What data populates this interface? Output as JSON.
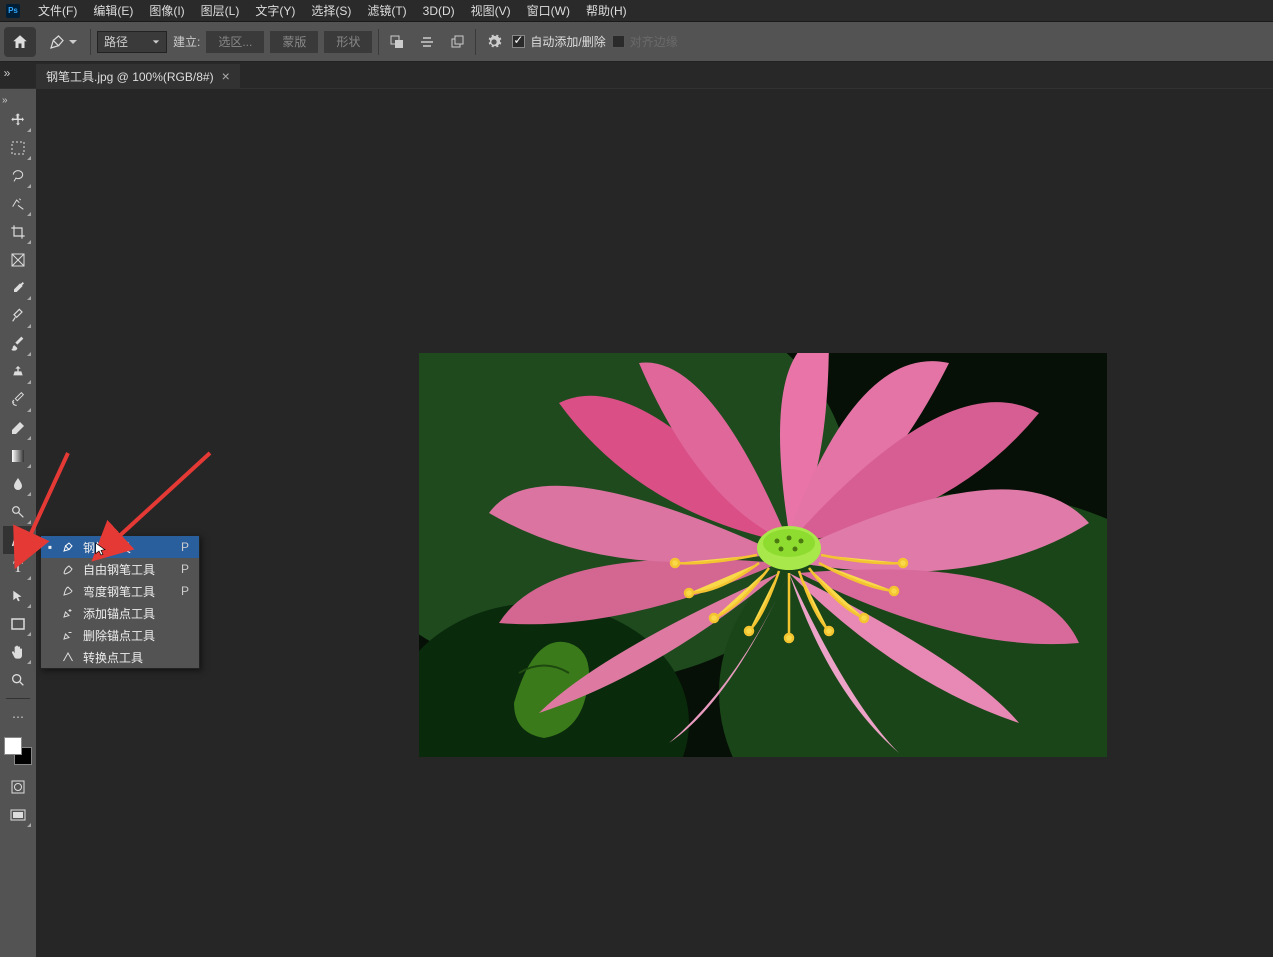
{
  "menubar": {
    "items": [
      "文件(F)",
      "编辑(E)",
      "图像(I)",
      "图层(L)",
      "文字(Y)",
      "选择(S)",
      "滤镜(T)",
      "3D(D)",
      "视图(V)",
      "窗口(W)",
      "帮助(H)"
    ]
  },
  "optionsbar": {
    "mode_select": "路径",
    "make_label": "建立:",
    "btn_selection": "选区...",
    "btn_mask": "蒙版",
    "btn_shape": "形状",
    "checkbox_label": "自动添加/删除",
    "snap_label": "对齐边缘"
  },
  "doctab": {
    "title": "钢笔工具.jpg @ 100%(RGB/8#)"
  },
  "flyout": {
    "items": [
      {
        "label": "钢笔工具",
        "key": "P",
        "selected": true,
        "icon": "pen"
      },
      {
        "label": "自由钢笔工具",
        "key": "P",
        "selected": false,
        "icon": "pen"
      },
      {
        "label": "弯度钢笔工具",
        "key": "P",
        "selected": false,
        "icon": "curve-pen"
      },
      {
        "label": "添加锚点工具",
        "key": "",
        "selected": false,
        "icon": "pen-plus"
      },
      {
        "label": "删除锚点工具",
        "key": "",
        "selected": false,
        "icon": "pen-minus"
      },
      {
        "label": "转换点工具",
        "key": "",
        "selected": false,
        "icon": "convert"
      }
    ]
  },
  "tools": [
    "move",
    "marquee",
    "lasso",
    "magic-wand",
    "crop",
    "frame",
    "eyedropper",
    "healing",
    "brush",
    "clone",
    "history-brush",
    "eraser",
    "gradient",
    "blur",
    "dodge",
    "pen",
    "text",
    "path-select",
    "rectangle",
    "hand",
    "zoom"
  ]
}
